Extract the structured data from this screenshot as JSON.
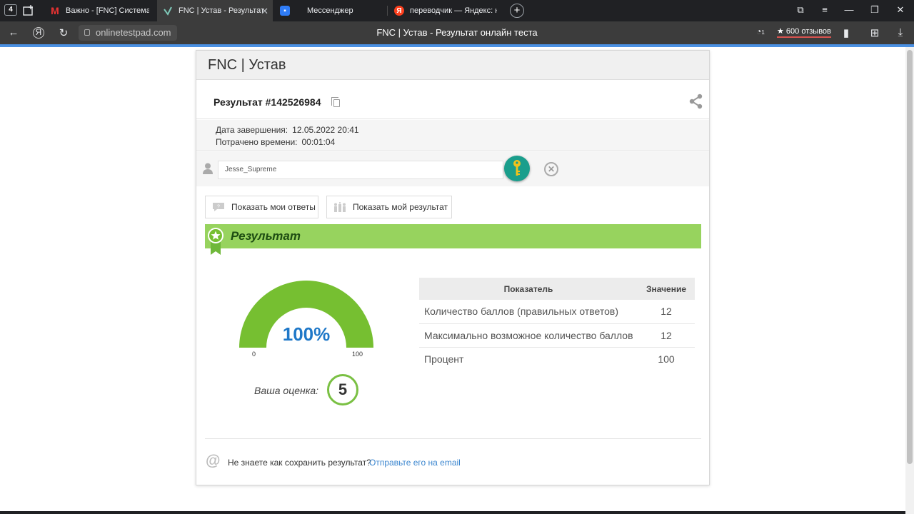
{
  "browser": {
    "tab_count": "4",
    "tabs": [
      {
        "label": "Важно - [FNC] Система по",
        "favicon": "mail-icon"
      },
      {
        "label": "FNC | Устав - Результат",
        "favicon": "onlinetestpad-icon"
      },
      {
        "label": "Мессенджер",
        "favicon": "messenger-icon"
      },
      {
        "label": "переводчик — Яндекс: на",
        "favicon": "yandex-icon"
      }
    ],
    "url": "onlinetestpad.com",
    "page_title": "FNC | Устав - Результат онлайн теста",
    "reviews": "600 отзывов",
    "notification_count": "1"
  },
  "card": {
    "title": "FNC | Устав",
    "result_title": "Результат #142526984",
    "meta": {
      "finish_label": "Дата завершения:",
      "finish_value": "12.05.2022 20:41",
      "spent_label": "Потрачено времени:",
      "spent_value": "00:01:04"
    },
    "user_name": "Jesse_Supreme",
    "buttons": {
      "show_answers": "Показать мои ответы",
      "show_result": "Показать мой результат"
    },
    "banner_title": "Результат",
    "gauge": {
      "value": 100,
      "label": "100%",
      "min": "0",
      "max": "100",
      "color": "#76bf31"
    },
    "grade_label": "Ваша оценка:",
    "grade_value": "5",
    "stats": {
      "headers": [
        "Показатель",
        "Значение"
      ],
      "rows": [
        [
          "Количество баллов (правильных ответов)",
          "12"
        ],
        [
          "Максимально возможное количество баллов",
          "12"
        ],
        [
          "Процент",
          "100"
        ]
      ]
    },
    "save_question": "Не знаете как сохранить результат?",
    "save_link": "Отправьте его на email"
  }
}
